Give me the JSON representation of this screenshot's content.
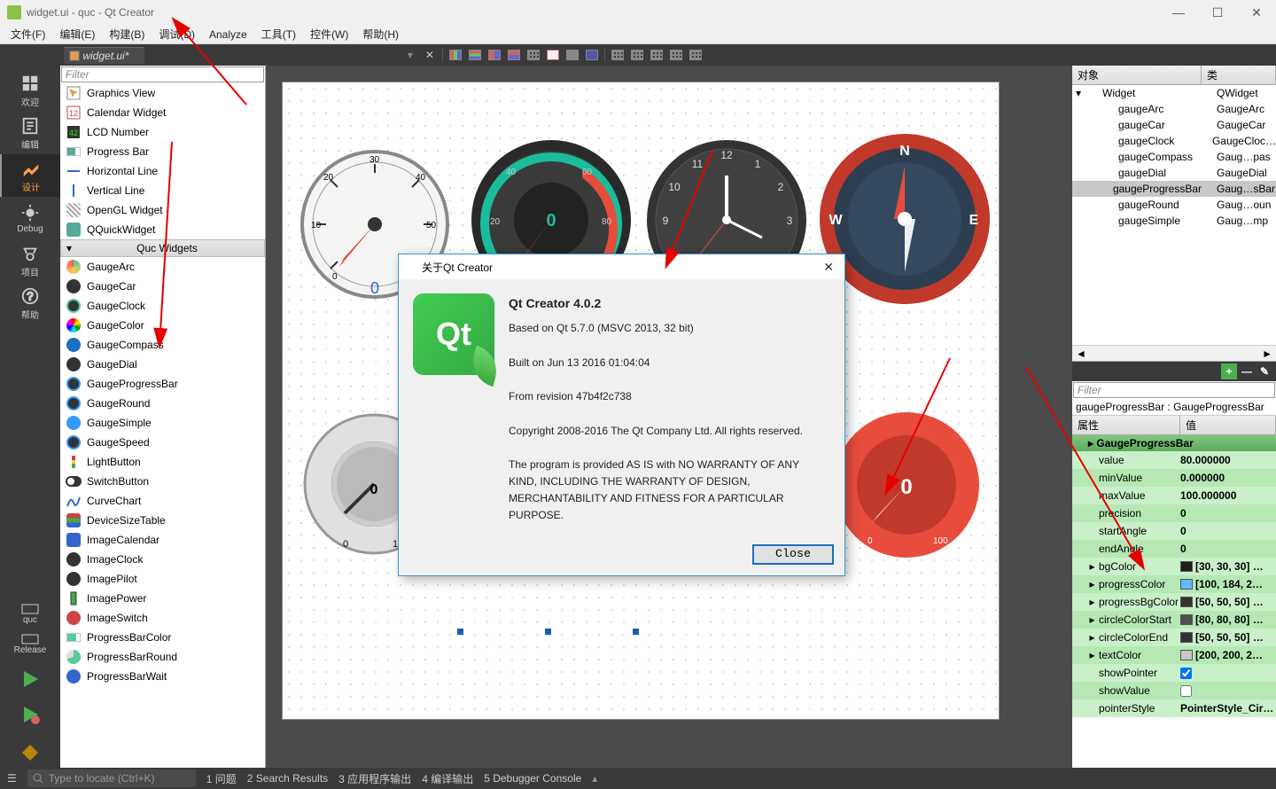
{
  "window_title": "widget.ui - quc - Qt Creator",
  "menus": [
    "文件(F)",
    "编辑(E)",
    "构建(B)",
    "调试(D)",
    "Analyze",
    "工具(T)",
    "控件(W)",
    "帮助(H)"
  ],
  "doc_tab": "widget.ui*",
  "mode_bar": {
    "items": [
      {
        "label": "欢迎"
      },
      {
        "label": "编辑"
      },
      {
        "label": "设计"
      },
      {
        "label": "Debug"
      },
      {
        "label": "项目"
      },
      {
        "label": "帮助"
      }
    ],
    "kit1": "quc",
    "kit2": "Release"
  },
  "widget_box": {
    "filter_placeholder": "Filter",
    "display_widgets": [
      "Graphics View",
      "Calendar Widget",
      "LCD Number",
      "Progress Bar",
      "Horizontal Line",
      "Vertical Line",
      "OpenGL Widget",
      "QQuickWidget"
    ],
    "quc_header": "Quc Widgets",
    "quc_widgets": [
      "GaugeArc",
      "GaugeCar",
      "GaugeClock",
      "GaugeColor",
      "GaugeCompass",
      "GaugeDial",
      "GaugeProgressBar",
      "GaugeRound",
      "GaugeSimple",
      "GaugeSpeed",
      "LightButton",
      "SwitchButton",
      "CurveChart",
      "DeviceSizeTable",
      "ImageCalendar",
      "ImageClock",
      "ImagePilot",
      "ImagePower",
      "ImageSwitch",
      "ProgressBarColor",
      "ProgressBarRound",
      "ProgressBarWait"
    ]
  },
  "obj_inspector": {
    "cols": [
      "对象",
      "类"
    ],
    "rows": [
      {
        "obj": "Widget",
        "cls": "QWidget",
        "indent": 0,
        "exp": true
      },
      {
        "obj": "gaugeArc",
        "cls": "GaugeArc",
        "indent": 1
      },
      {
        "obj": "gaugeCar",
        "cls": "GaugeCar",
        "indent": 1
      },
      {
        "obj": "gaugeClock",
        "cls": "GaugeCloc…",
        "indent": 1
      },
      {
        "obj": "gaugeCompass",
        "cls": "Gaug…pas",
        "indent": 1
      },
      {
        "obj": "gaugeDial",
        "cls": "GaugeDial",
        "indent": 1
      },
      {
        "obj": "gaugeProgressBar",
        "cls": "Gaug…sBar",
        "indent": 1,
        "sel": true
      },
      {
        "obj": "gaugeRound",
        "cls": "Gaug…oun",
        "indent": 1
      },
      {
        "obj": "gaugeSimple",
        "cls": "Gaug…mp",
        "indent": 1
      }
    ]
  },
  "prop": {
    "filter": "Filter",
    "info": "gaugeProgressBar : GaugeProgressBar",
    "cols": [
      "属性",
      "值"
    ],
    "cat": "GaugeProgressBar",
    "rows": [
      {
        "k": "value",
        "v": "80.000000"
      },
      {
        "k": "minValue",
        "v": "0.000000"
      },
      {
        "k": "maxValue",
        "v": "100.000000"
      },
      {
        "k": "precision",
        "v": "0"
      },
      {
        "k": "startAngle",
        "v": "0"
      },
      {
        "k": "endAngle",
        "v": "0"
      },
      {
        "k": "bgColor",
        "v": "[30, 30, 30] …",
        "c": "#1e1e1e",
        "exp": true
      },
      {
        "k": "progressColor",
        "v": "[100, 184, 2…",
        "c": "#64b8ff",
        "exp": true
      },
      {
        "k": "progressBgColor",
        "v": "[50, 50, 50] …",
        "c": "#323232",
        "exp": true
      },
      {
        "k": "circleColorStart",
        "v": "[80, 80, 80] …",
        "c": "#505050",
        "exp": true
      },
      {
        "k": "circleColorEnd",
        "v": "[50, 50, 50] …",
        "c": "#323232",
        "exp": true
      },
      {
        "k": "textColor",
        "v": "[200, 200, 2…",
        "c": "#c8c8c8",
        "exp": true
      },
      {
        "k": "showPointer",
        "v": "",
        "check": true
      },
      {
        "k": "showValue",
        "v": "",
        "check": false
      },
      {
        "k": "pointerStyle",
        "v": "PointerStyle_Cir…"
      }
    ]
  },
  "status": {
    "locate": "Type to locate (Ctrl+K)",
    "tabs": [
      "1 问题",
      "2 Search Results",
      "3 应用程序输出",
      "4 编译输出",
      "5 Debugger Console"
    ]
  },
  "dialog": {
    "title": "关于Qt Creator",
    "product": "Qt Creator 4.0.2",
    "based": "Based on Qt 5.7.0 (MSVC 2013, 32 bit)",
    "built": "Built on Jun 13 2016 01:04:04",
    "rev": "From revision 47b4f2c738",
    "copyright": "Copyright 2008-2016 The Qt Company Ltd. All rights reserved.",
    "warranty": "The program is provided AS IS with NO WARRANTY OF ANY KIND, INCLUDING THE WARRANTY OF DESIGN, MERCHANTABILITY AND FITNESS FOR A PARTICULAR PURPOSE.",
    "close": "Close"
  }
}
